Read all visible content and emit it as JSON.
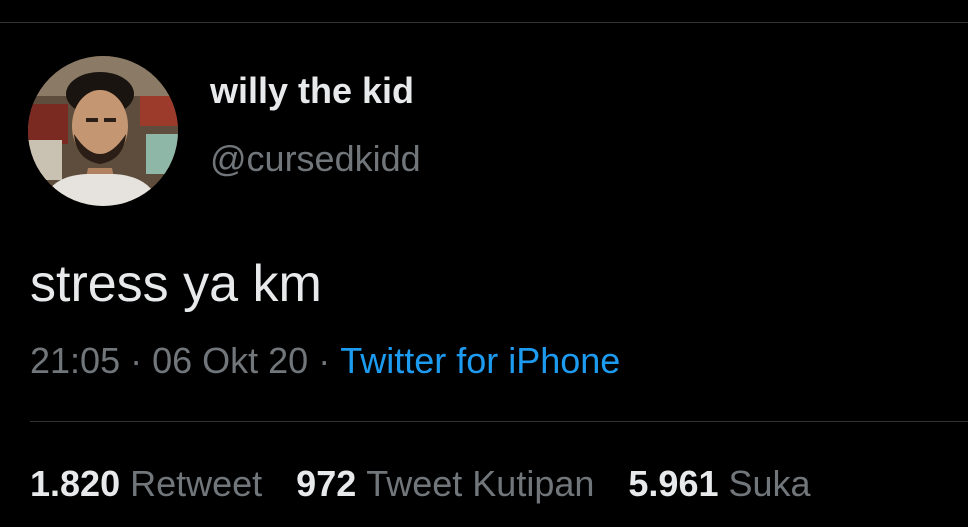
{
  "colors": {
    "background": "#000000",
    "text_primary": "#e7e9ea",
    "text_secondary": "#71767b",
    "link": "#1d9bf0",
    "divider": "#2f3336"
  },
  "tweet": {
    "author": {
      "display_name": "willy the kid",
      "handle": "@cursedkidd",
      "avatar_icon": "profile-photo"
    },
    "text": "stress ya km",
    "meta": {
      "time": "21:05",
      "separator": "·",
      "date": "06 Okt 20",
      "source": "Twitter for iPhone"
    },
    "stats": {
      "retweets": {
        "count": "1.820",
        "label": "Retweet"
      },
      "quotes": {
        "count": "972",
        "label": "Tweet Kutipan"
      },
      "likes": {
        "count": "5.961",
        "label": "Suka"
      }
    }
  }
}
